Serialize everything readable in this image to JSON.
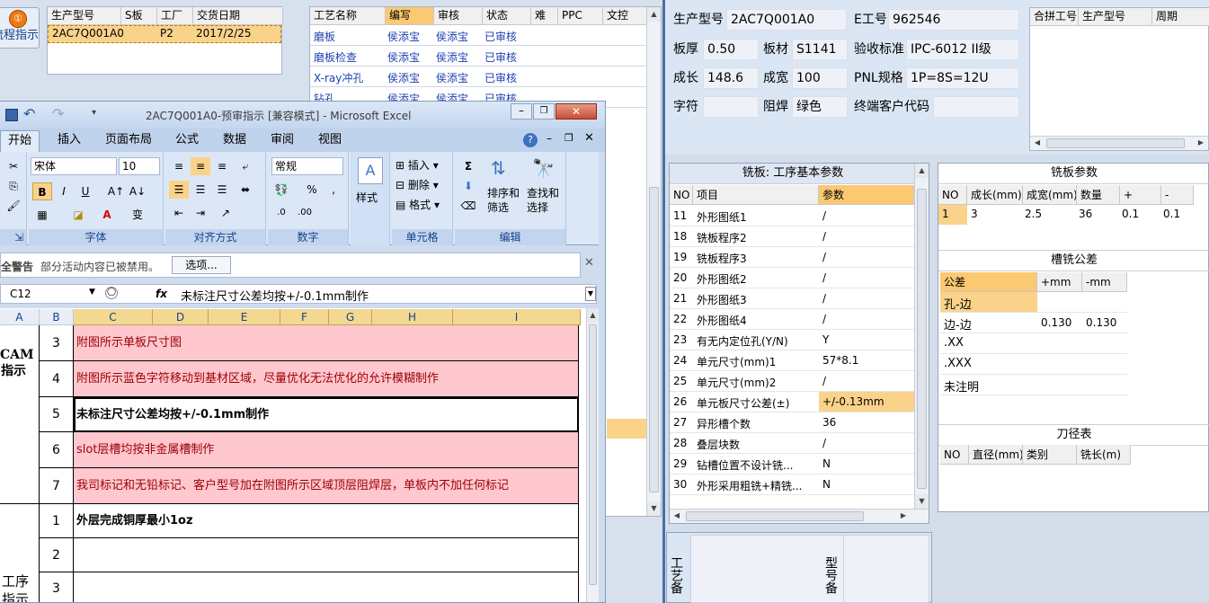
{
  "left_top": {
    "flow_btn": "流程指示",
    "model_table": {
      "headers": [
        "生产型号",
        "S板",
        "工厂",
        "交货日期"
      ],
      "rows": [
        [
          "2AC7Q001A0",
          "",
          "P2",
          "2017/2/25"
        ]
      ]
    },
    "process_table": {
      "headers": [
        "工艺名称",
        "编写",
        "审核",
        "状态",
        "难",
        "PPC",
        "文控"
      ],
      "rows": [
        [
          "磨板",
          "侯添宝",
          "侯添宝",
          "已审核"
        ],
        [
          "磨板检查",
          "侯添宝",
          "侯添宝",
          "已审核"
        ],
        [
          "X-ray冲孔",
          "侯添宝",
          "侯添宝",
          "已审核"
        ],
        [
          "钻孔",
          "侯添宝",
          "侯添宝",
          "已审核"
        ]
      ]
    }
  },
  "info": {
    "model_label": "生产型号",
    "model": "2AC7Q001A0",
    "e_label": "E工号",
    "e": "962546",
    "thick_label": "板厚",
    "thick": "0.50",
    "mat_label": "板材",
    "mat": "S1141",
    "std_label": "验收标准",
    "std": "IPC-6012 II级",
    "len_label": "成长",
    "len": "148.6",
    "wid_label": "成宽",
    "wid": "100",
    "pnl_label": "PNL规格",
    "pnl": "1P=8S=12U",
    "char_label": "字符",
    "char": "",
    "mask_label": "阻焊",
    "mask": "绿色",
    "cust_label": "终端客户代码",
    "cust": ""
  },
  "combine": {
    "headers": [
      "合拼工号",
      "生产型号",
      "周期"
    ]
  },
  "milling": {
    "title": "铣板: 工序基本参数",
    "headers": [
      "NO",
      "项目",
      "参数"
    ],
    "rows": [
      [
        "11",
        "外形图纸1",
        "/"
      ],
      [
        "18",
        "铣板程序2",
        "/"
      ],
      [
        "19",
        "铣板程序3",
        "/"
      ],
      [
        "20",
        "外形图纸2",
        "/"
      ],
      [
        "21",
        "外形图纸3",
        "/"
      ],
      [
        "22",
        "外形图纸4",
        "/"
      ],
      [
        "23",
        "有无内定位孔(Y/N)",
        "Y"
      ],
      [
        "24",
        "单元尺寸(mm)1",
        "57*8.1"
      ],
      [
        "25",
        "单元尺寸(mm)2",
        "/"
      ],
      [
        "26",
        "单元板尺寸公差(±)",
        "+/-0.13mm"
      ],
      [
        "27",
        "异形槽个数",
        "36"
      ],
      [
        "28",
        "叠层块数",
        "/"
      ],
      [
        "29",
        "钻槽位置不设计铣...",
        "N"
      ],
      [
        "30",
        "外形采用粗铣+精铣...",
        "N"
      ]
    ]
  },
  "mill_params": {
    "title": "铣板参数",
    "headers": [
      "NO",
      "成长(mm)",
      "成宽(mm)",
      "数量",
      "+",
      "-"
    ],
    "rows": [
      [
        "1",
        "3",
        "2.5",
        "36",
        "0.1",
        "0.1"
      ]
    ]
  },
  "slot_tol": {
    "title": "槽铣公差",
    "headers": [
      "公差",
      "+mm",
      "-mm"
    ],
    "rows": [
      [
        "孔-边",
        "",
        ""
      ],
      [
        "边-边",
        "0.130",
        "0.130"
      ],
      [
        ".XX",
        "",
        ""
      ],
      [
        ".XXX",
        "",
        ""
      ],
      [
        "未注明",
        "",
        ""
      ]
    ]
  },
  "tool_table": {
    "title": "刀径表",
    "headers": [
      "NO",
      "直径(mm)",
      "类别",
      "铣长(m)"
    ]
  },
  "bottom": {
    "left_label": "工艺备",
    "right_label": "型号备"
  },
  "excel": {
    "title": "2AC7Q001A0-预审指示 [兼容模式] - Microsoft Excel",
    "tabs": [
      "开始",
      "插入",
      "页面布局",
      "公式",
      "数据",
      "审阅",
      "视图"
    ],
    "font_name": "宋体",
    "font_size": "10",
    "number_format": "常规",
    "groups": [
      "字体",
      "对齐方式",
      "数字",
      "单元格",
      "编辑"
    ],
    "style_label": "样式",
    "insert_label": "插入",
    "delete_label": "删除",
    "format_label": "格式",
    "sort_label": "排序和筛选",
    "find_label": "查找和选择",
    "security_label": "全警告",
    "security_msg": "部分活动内容已被禁用。",
    "options_btn": "选项...",
    "cell_ref": "C12",
    "fx": "fx",
    "formula": "未标注尺寸公差均按+/-0.1mm制作",
    "col_headers": [
      "A",
      "B",
      "C",
      "D",
      "E",
      "F",
      "G",
      "H",
      "I"
    ],
    "section1": "CAM指示",
    "section2": "工序指示",
    "rows": [
      {
        "no": "3",
        "text": "附图所示单板尺寸图"
      },
      {
        "no": "4",
        "text": "附图所示蓝色字符移动到基材区域，尽量优化无法优化的允许模糊制作"
      },
      {
        "no": "5",
        "text": "未标注尺寸公差均按+/-0.1mm制作"
      },
      {
        "no": "6",
        "text": "slot层槽均按非金属槽制作"
      },
      {
        "no": "7",
        "text": "我司标记和无铅标记、客户型号加在附图所示区域顶层阻焊层，单板内不加任何标记"
      },
      {
        "no": "1",
        "text": "外层完成铜厚最小1oz"
      },
      {
        "no": "2",
        "text": ""
      },
      {
        "no": "3",
        "text": ""
      }
    ]
  }
}
